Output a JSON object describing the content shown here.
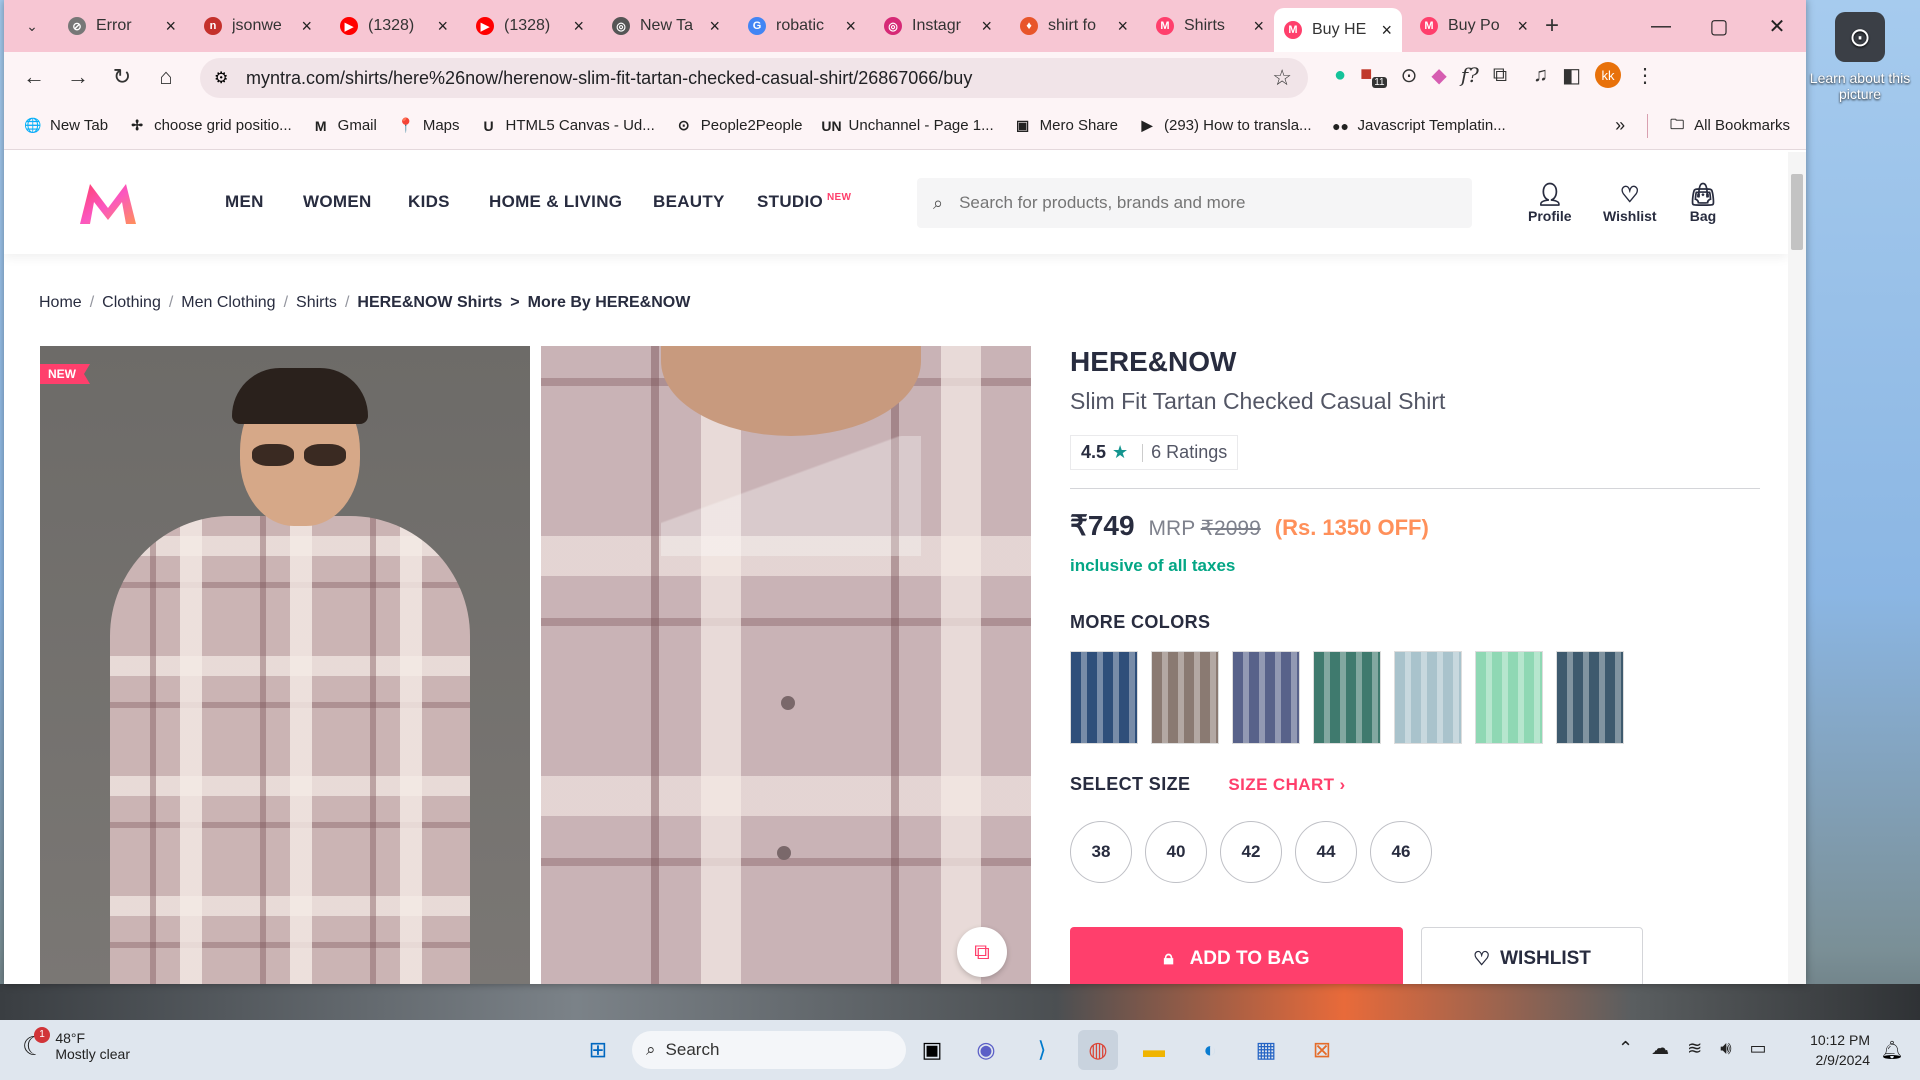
{
  "browser": {
    "tabs": [
      {
        "title": "Error",
        "fav_color": "#777777",
        "fav_glyph": "⊘"
      },
      {
        "title": "jsonwe",
        "fav_color": "#c4302b",
        "fav_glyph": "n"
      },
      {
        "title": "(1328)",
        "fav_color": "#ff0000",
        "fav_glyph": "▶"
      },
      {
        "title": "(1328)",
        "fav_color": "#ff0000",
        "fav_glyph": "▶"
      },
      {
        "title": "New Ta",
        "fav_color": "#555555",
        "fav_glyph": "◎"
      },
      {
        "title": "robatic",
        "fav_color": "#4285f4",
        "fav_glyph": "G"
      },
      {
        "title": "Instagr",
        "fav_color": "#d62976",
        "fav_glyph": "◎"
      },
      {
        "title": "shirt fo",
        "fav_color": "#e8552a",
        "fav_glyph": "♦"
      },
      {
        "title": "Shirts",
        "fav_color": "#ff3f6c",
        "fav_glyph": "M"
      },
      {
        "title": "Buy HE",
        "fav_color": "#ff3f6c",
        "fav_glyph": "M",
        "active": true
      },
      {
        "title": "Buy Po",
        "fav_color": "#ff3f6c",
        "fav_glyph": "M"
      }
    ],
    "url": "myntra.com/shirts/here%26now/herenow-slim-fit-tartan-checked-casual-shirt/26867066/buy",
    "profile_initials": "kk",
    "ext_badge": "11",
    "bookmarks": [
      {
        "label": "New Tab",
        "icon": "globe-icon",
        "glyph": "🌐"
      },
      {
        "label": "choose grid positio...",
        "icon": "cursor-icon",
        "glyph": "✢"
      },
      {
        "label": "Gmail",
        "icon": "gmail-icon",
        "glyph": "M"
      },
      {
        "label": "Maps",
        "icon": "maps-icon",
        "glyph": "📍"
      },
      {
        "label": "HTML5 Canvas - Ud...",
        "icon": "udemy-icon",
        "glyph": "U"
      },
      {
        "label": "People2People",
        "icon": "people-icon",
        "glyph": "⊙"
      },
      {
        "label": "Unchannel - Page 1...",
        "icon": "un-icon",
        "glyph": "UN"
      },
      {
        "label": "Mero Share",
        "icon": "meroshare-icon",
        "glyph": "▣"
      },
      {
        "label": "(293) How to transla...",
        "icon": "youtube-icon",
        "glyph": "▶"
      },
      {
        "label": "Javascript Templatin...",
        "icon": "medium-icon",
        "glyph": "●●"
      }
    ],
    "all_bookmarks": "All Bookmarks"
  },
  "site": {
    "nav": [
      "MEN",
      "WOMEN",
      "KIDS",
      "HOME & LIVING",
      "BEAUTY",
      "STUDIO"
    ],
    "studio_badge": "NEW",
    "search_placeholder": "Search for products, brands and more",
    "actions": [
      "Profile",
      "Wishlist",
      "Bag"
    ]
  },
  "breadcrumb": [
    "Home",
    "Clothing",
    "Men Clothing",
    "Shirts",
    "HERE&NOW Shirts",
    "More By HERE&NOW"
  ],
  "product": {
    "new_badge": "NEW",
    "brand": "HERE&NOW",
    "name": "Slim Fit Tartan Checked Casual Shirt",
    "rating": "4.5",
    "rating_star": "★",
    "ratings_count": "6 Ratings",
    "price": "₹749",
    "mrp_label": "MRP",
    "mrp": "₹2099",
    "discount": "(Rs. 1350 OFF)",
    "tax_note": "inclusive of all taxes",
    "more_colors_label": "MORE COLORS",
    "color_swatches": [
      "#2f4f7a",
      "#8a7a72",
      "#58628a",
      "#3f7a6e",
      "#a9c3cc",
      "#8fd8b4",
      "#3e5a6e"
    ],
    "select_size_label": "SELECT SIZE",
    "size_chart_label": "SIZE CHART",
    "sizes": [
      "38",
      "40",
      "42",
      "44",
      "46"
    ],
    "add_to_bag": "ADD TO BAG",
    "wishlist": "WISHLIST"
  },
  "desktop": {
    "learn_picture": "Learn about this picture"
  },
  "taskbar": {
    "weather_temp": "48°F",
    "weather_desc": "Mostly clear",
    "weather_badge": "1",
    "search_label": "Search",
    "time": "10:12 PM",
    "date": "2/9/2024"
  }
}
